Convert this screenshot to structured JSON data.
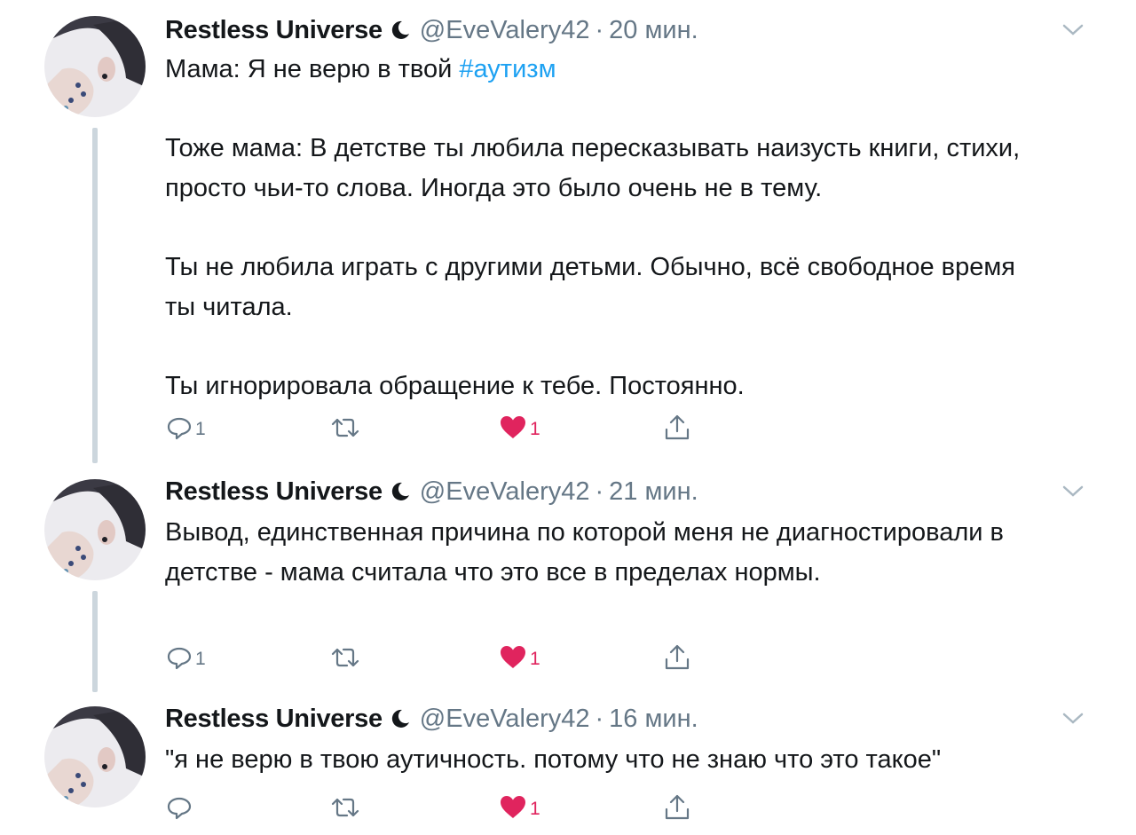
{
  "tweets": [
    {
      "author_name": "Restless Universe",
      "handle": "@EveValery42",
      "separator": "·",
      "time": "20 мин.",
      "text_prefix": "Мама: Я не верю в твой ",
      "hashtag": "#аутизм",
      "paragraphs": [
        "Тоже мама: В детстве ты любила пересказывать наизусть книги, стихи, просто чьи-то слова. Иногда это было очень не в тему.",
        "Ты не любила играть с другими детьми. Обычно, всё свободное время ты читала.",
        "Ты игнорировала обращение к тебе. Постоянно."
      ],
      "reply_count": "1",
      "retweet_count": "",
      "like_count": "1",
      "liked": true
    },
    {
      "author_name": "Restless Universe",
      "handle": "@EveValery42",
      "separator": "·",
      "time": "21 мин.",
      "text": "Вывод, единственная причина по которой меня не диагностировали в детстве - мама считала что это все в пределах нормы.",
      "reply_count": "1",
      "retweet_count": "",
      "like_count": "1",
      "liked": true
    },
    {
      "author_name": "Restless Universe",
      "handle": "@EveValery42",
      "separator": "·",
      "time": "16 мин.",
      "text": "\"я не верю в твою аутичность. потому что не знаю что это такое\"",
      "reply_count": "",
      "retweet_count": "",
      "like_count": "1",
      "liked": true
    }
  ],
  "icons": {
    "reply": "reply-icon",
    "retweet": "retweet-icon",
    "like": "heart-icon",
    "share": "share-icon",
    "caret": "chevron-down-icon",
    "moon": "crescent-moon-icon"
  },
  "colors": {
    "text": "#14171a",
    "muted": "#657786",
    "hashtag": "#1da1f2",
    "like": "#e0245e",
    "thread_line": "#ccd6dd"
  }
}
